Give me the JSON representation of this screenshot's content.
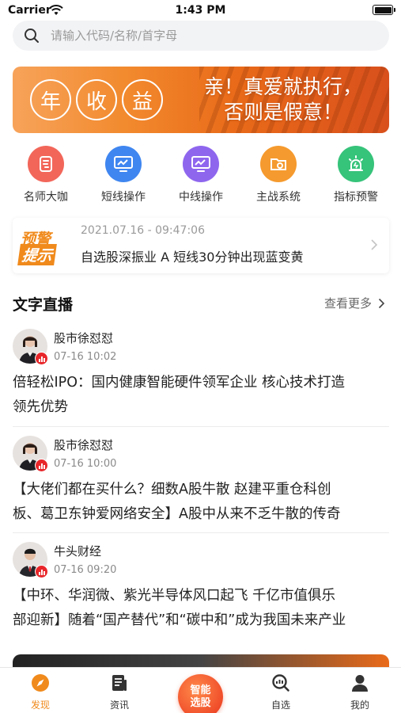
{
  "status_bar": {
    "carrier": "Carrier",
    "time": "1:43 PM"
  },
  "search": {
    "placeholder": "请输入代码/名称/首字母"
  },
  "banner": {
    "circles": [
      "年",
      "收",
      "益"
    ],
    "slogan_line1": "亲！真爱就执行，",
    "slogan_line2": "否则是假意！"
  },
  "quick_nav": {
    "items": [
      {
        "label": "名师大咖",
        "icon": "notebook-icon",
        "color": "#f2665a"
      },
      {
        "label": "短线操作",
        "icon": "monitor-chart-icon",
        "color": "#3f86f0"
      },
      {
        "label": "中线操作",
        "icon": "monitor-chart-icon",
        "color": "#8e66ee"
      },
      {
        "label": "主战系统",
        "icon": "folder-gear-icon",
        "color": "#f59a2e"
      },
      {
        "label": "指标预警",
        "icon": "alarm-icon",
        "color": "#36c37a"
      }
    ]
  },
  "alert": {
    "badge_line1": "预警",
    "badge_line2": "提示",
    "time": "2021.07.16 - 09:47:06",
    "text": "自选股深振业 A 短线30分钟出现蓝变黄"
  },
  "live": {
    "title": "文字直播",
    "more": "查看更多",
    "posts": [
      {
        "author": "股市徐怼怼",
        "time": "07-16 10:02",
        "line1": "倍轻松IPO：国内健康智能硬件领军企业 核心技术打造",
        "line2": "领先优势"
      },
      {
        "author": "股市徐怼怼",
        "time": "07-16 10:00",
        "line1": "【大佬们都在买什么？细数A股牛散 赵建平重仓科创",
        "line2": "板、葛卫东钟爱网络安全】A股中从来不乏牛散的传奇"
      },
      {
        "author": "牛头财经",
        "time": "07-16 09:20",
        "line1": "【中环、华润微、紫光半导体风口起飞 千亿市值俱乐",
        "line2": "部迎新】随着“国产替代”和“碳中和”成为我国未来产业"
      }
    ]
  },
  "tab_bar": {
    "tabs": [
      {
        "label": "发现",
        "icon": "compass-icon",
        "active": true
      },
      {
        "label": "资讯",
        "icon": "news-icon",
        "active": false
      },
      {
        "label": "自选",
        "icon": "chart-search-icon",
        "active": false
      },
      {
        "label": "我的",
        "icon": "user-icon",
        "active": false
      }
    ],
    "center_line1": "智能",
    "center_line2": "选股"
  },
  "colors": {
    "accent": "#f08a1c",
    "badge_red": "#e8262a"
  }
}
